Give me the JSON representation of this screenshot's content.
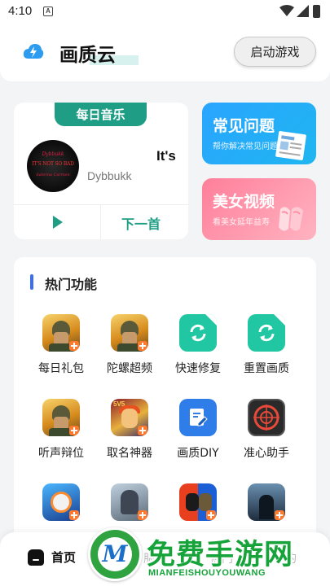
{
  "status_bar": {
    "time": "4:10",
    "notification_glyph": "A"
  },
  "app_bar": {
    "title": "画质云",
    "start_button": "启动游戏"
  },
  "music_card": {
    "tab": "每日音乐",
    "song_title": "It's",
    "artist": "Dybbukk",
    "album_line1": "Dybbukk",
    "album_line2": "IT'S NOT SO BAD",
    "album_line3": "Sabrina Carmen",
    "next_label": "下一首"
  },
  "faq_card": {
    "title": "常见问题",
    "subtitle": "帮你解决常见问题"
  },
  "beauty_card": {
    "title": "美女视频",
    "subtitle": "看美女延年益寿"
  },
  "hot_features": {
    "title": "热门功能",
    "items": [
      {
        "label": "每日礼包",
        "icon": "pubg-soldier-icon"
      },
      {
        "label": "陀螺超频",
        "icon": "pubg-soldier-icon"
      },
      {
        "label": "快速修复",
        "icon": "refresh-icon"
      },
      {
        "label": "重置画质",
        "icon": "refresh-icon"
      },
      {
        "label": "听声辩位",
        "icon": "pubg-soldier-icon"
      },
      {
        "label": "取名神器",
        "icon": "hero-avatar-icon"
      },
      {
        "label": "画质DIY",
        "icon": "edit-document-icon"
      },
      {
        "label": "准心助手",
        "icon": "crosshair-icon"
      }
    ]
  },
  "bottom_nav": {
    "home_label": "首页",
    "ghost_1": "服",
    "ghost_2": "热门",
    "ghost_3": "我的"
  },
  "watermark": {
    "text": "免费手游网",
    "subtext": "MIANFEISHOUYOUWANG",
    "logo_letter": "M"
  },
  "colors": {
    "accent_teal": "#1f9e85",
    "faq_blue": "#2aa4ff",
    "beauty_pink": "#ff7f9a",
    "heading_bar": "#3d6ef2",
    "repair_green": "#21c7a2",
    "diy_blue": "#2e7de8"
  }
}
